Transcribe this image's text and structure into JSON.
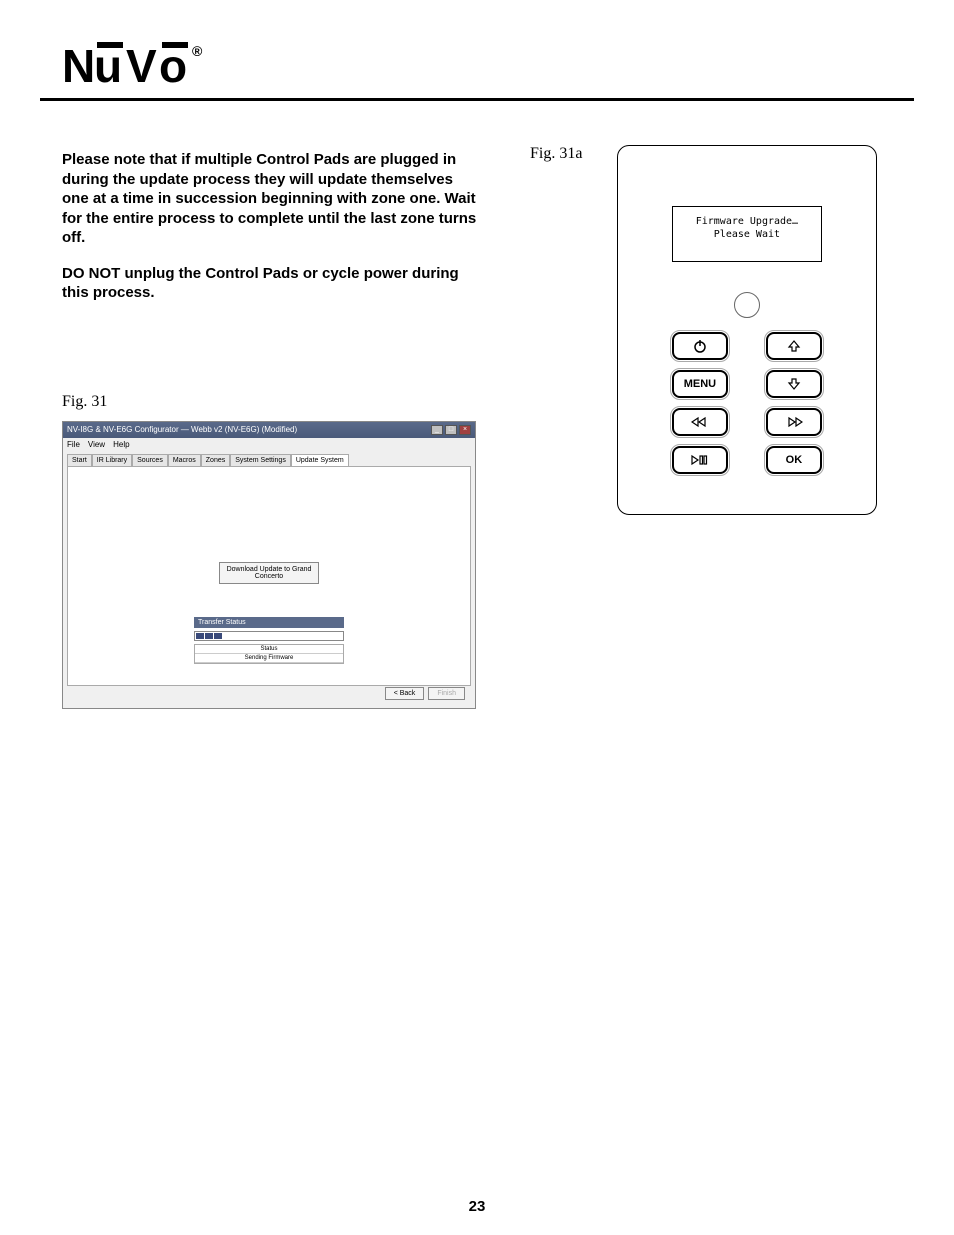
{
  "brand": "NuVo",
  "paragraphs": {
    "p1": "Please note that if multiple Control Pads are plugged in during the update process they will update themselves one at a time in succession beginning with zone one. Wait for the entire process to complete until the last zone turns off.",
    "p2": "DO NOT unplug the Control Pads or cycle power during this process."
  },
  "fig31_caption": "Fig. 31",
  "fig31a_caption": "Fig. 31a",
  "page_number": "23",
  "app_window": {
    "title": "NV-I8G & NV-E6G Configurator — Webb v2 (NV-E6G) (Modified)",
    "menu": [
      "File",
      "View",
      "Help"
    ],
    "tabs": [
      "Start",
      "IR Library",
      "Sources",
      "Macros",
      "Zones",
      "System Settings",
      "Update System"
    ],
    "active_tab": "Update System",
    "download_button": "Download Update to Grand Concerto",
    "transfer_status_title": "Transfer Status",
    "status_header": "Status",
    "status_value": "Sending Firmware",
    "back_button": "< Back",
    "finish_button": "Finish"
  },
  "control_pad": {
    "screen_line1": "Firmware Upgrade…",
    "screen_line2": "Please Wait",
    "buttons": {
      "power": "⏻",
      "menu": "MENU",
      "prev": "⏪",
      "play": "▷❚❚",
      "up": "⇧",
      "down": "⇩",
      "next": "⏩",
      "ok": "OK"
    }
  }
}
